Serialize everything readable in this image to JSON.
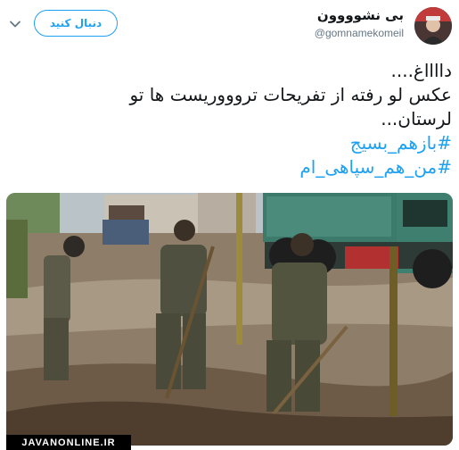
{
  "account": {
    "display_name": "بی نشوووون",
    "handle": "@gomnamekomeil",
    "follow_label": "دنبال کنید"
  },
  "tweet": {
    "lines": [
      "دااااغ....",
      "عکس لو رفته از تفریحات تروووریست ها تو",
      "لرستان..."
    ],
    "hashtags": [
      "#بازهم_بسیج",
      "#من_هم_سپاهی_ام"
    ]
  },
  "media": {
    "watermark": "JAVANONLINE.IR"
  },
  "colors": {
    "accent": "#1da1f2",
    "text": "#14171a",
    "secondary": "#657786"
  },
  "icons": {
    "menu": "chevron-down-icon",
    "avatar": "avatar"
  }
}
